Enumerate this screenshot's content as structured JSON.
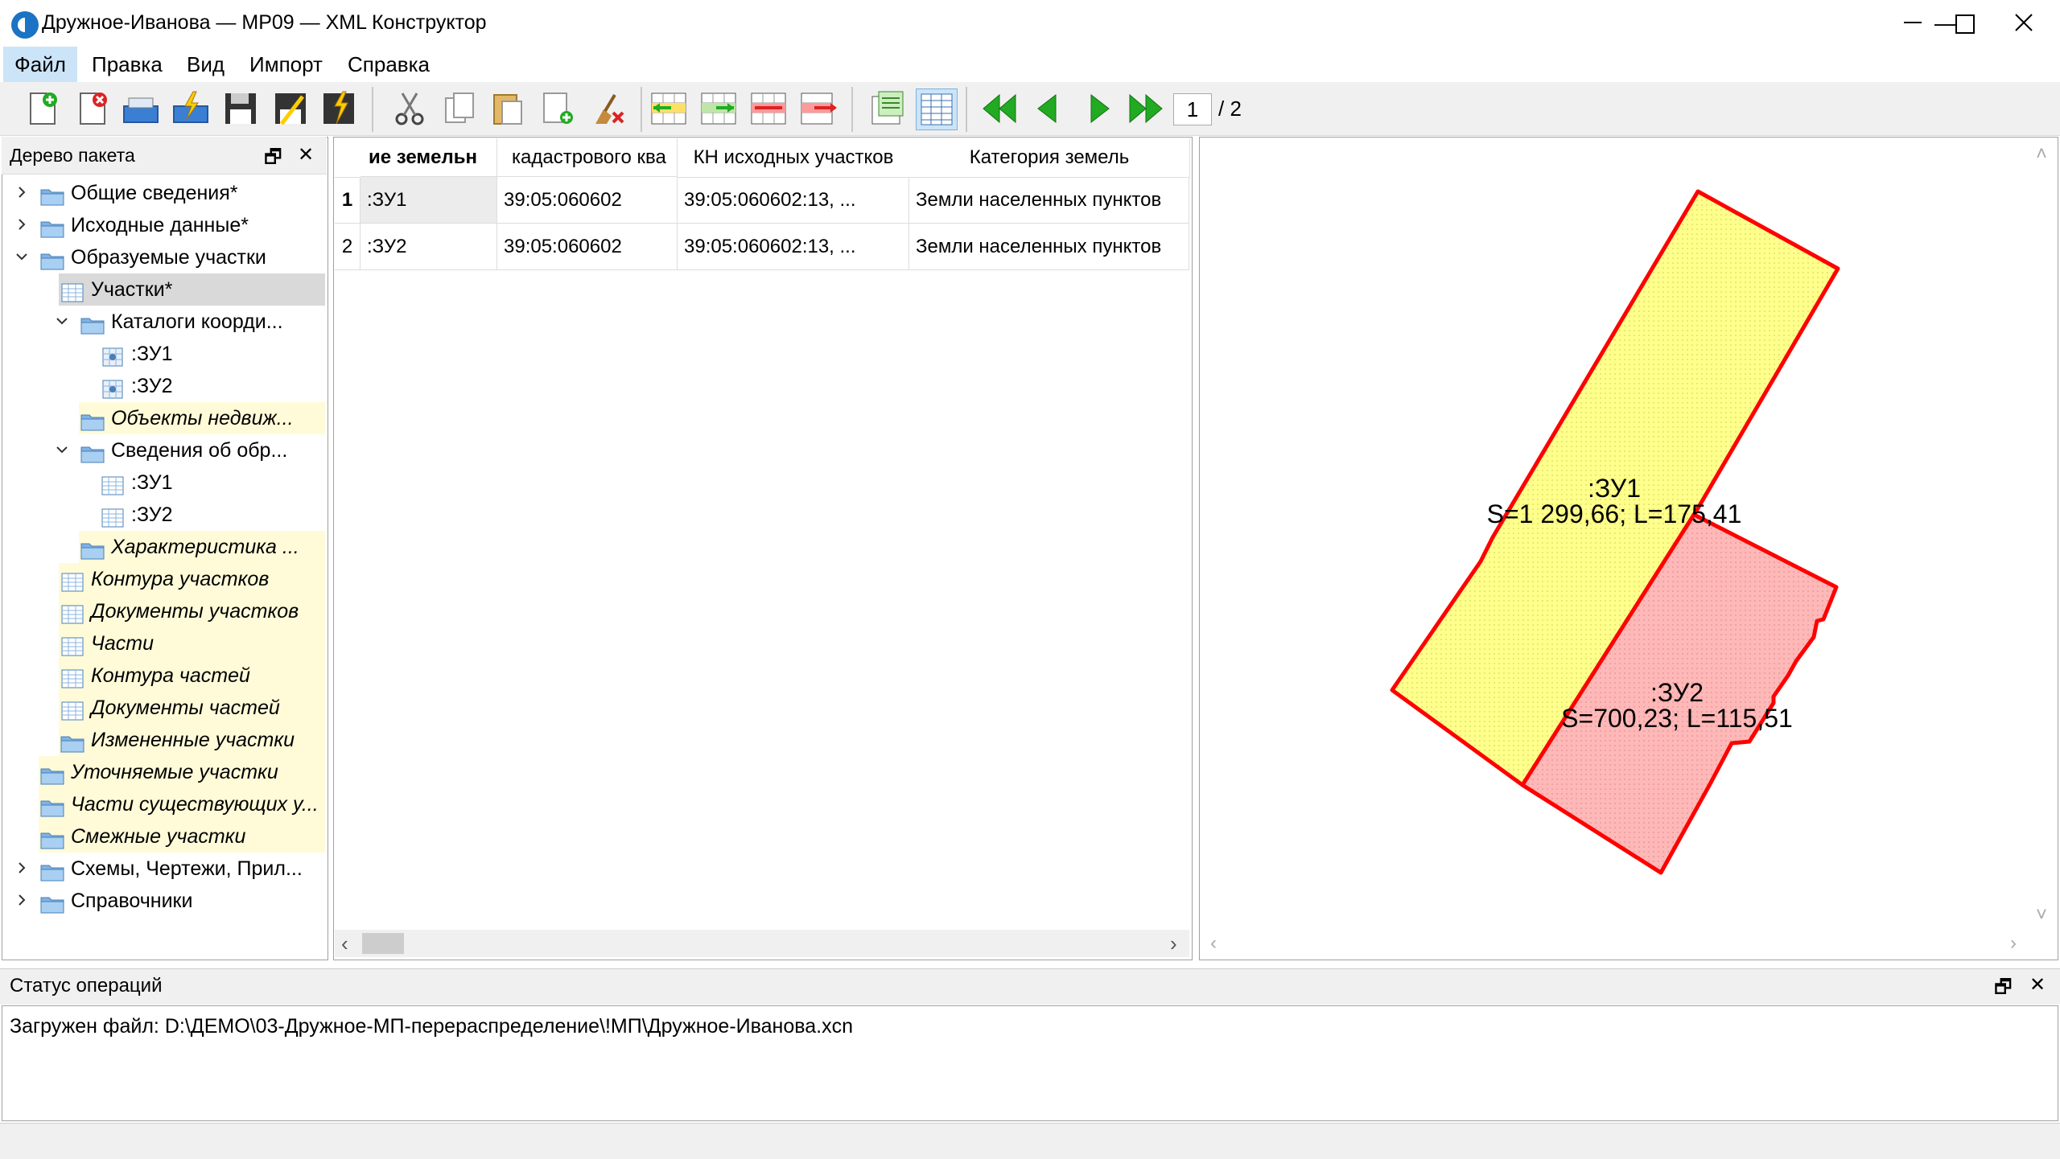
{
  "window": {
    "title": "Дружное-Иванова — МР09 — XML Конструктор",
    "minimize": "—",
    "maximize": "☐",
    "close": "✕"
  },
  "menu": [
    "Файл",
    "Правка",
    "Вид",
    "Импорт",
    "Справка"
  ],
  "toolbar": {
    "page_current": "1",
    "page_total": "/ 2"
  },
  "tree": {
    "title": "Дерево пакета",
    "items": [
      {
        "label": "Общие сведения*",
        "level": 0,
        "expander": "collapsed",
        "icon": "folder-icon",
        "style": "normal"
      },
      {
        "label": "Исходные данные*",
        "level": 0,
        "expander": "collapsed",
        "icon": "folder-icon",
        "style": "normal"
      },
      {
        "label": "Образуемые участки",
        "level": 0,
        "expander": "expanded",
        "icon": "folder-icon",
        "style": "normal"
      },
      {
        "label": "Участки*",
        "level": 1,
        "expander": "expanded",
        "icon": "table-icon",
        "style": "selected"
      },
      {
        "label": "Каталоги коорди...",
        "level": 2,
        "expander": "expanded",
        "icon": "folder-icon",
        "style": "normal"
      },
      {
        "label": ":ЗУ1",
        "level": 3,
        "expander": "none",
        "icon": "coord-table-icon",
        "style": "normal"
      },
      {
        "label": ":ЗУ2",
        "level": 3,
        "expander": "none",
        "icon": "coord-table-icon",
        "style": "normal"
      },
      {
        "label": "Объекты недвиж...",
        "level": 2,
        "expander": "collapsed",
        "icon": "folder-icon",
        "style": "yellow"
      },
      {
        "label": "Сведения об обр...",
        "level": 2,
        "expander": "expanded",
        "icon": "folder-icon",
        "style": "normal"
      },
      {
        "label": ":ЗУ1",
        "level": 3,
        "expander": "none",
        "icon": "table-icon",
        "style": "normal"
      },
      {
        "label": ":ЗУ2",
        "level": 3,
        "expander": "none",
        "icon": "table-icon",
        "style": "normal"
      },
      {
        "label": "Характеристика ...",
        "level": 2,
        "expander": "collapsed",
        "icon": "folder-icon",
        "style": "yellow"
      },
      {
        "label": "Контура участков",
        "level": 1,
        "expander": "collapsed",
        "icon": "table-icon",
        "style": "yellow"
      },
      {
        "label": "Документы участков",
        "level": 1,
        "expander": "none",
        "icon": "table-icon",
        "style": "yellow"
      },
      {
        "label": "Части",
        "level": 1,
        "expander": "collapsed",
        "icon": "table-icon",
        "style": "yellow"
      },
      {
        "label": "Контура частей",
        "level": 1,
        "expander": "collapsed",
        "icon": "table-icon",
        "style": "yellow"
      },
      {
        "label": "Документы частей",
        "level": 1,
        "expander": "none",
        "icon": "table-icon",
        "style": "yellow"
      },
      {
        "label": "Измененные участки",
        "level": 1,
        "expander": "collapsed",
        "icon": "folder-icon",
        "style": "yellow"
      },
      {
        "label": "Уточняемые участки",
        "level": 0,
        "expander": "collapsed",
        "icon": "folder-icon",
        "style": "yellow"
      },
      {
        "label": "Части существующих у...",
        "level": 0,
        "expander": "collapsed",
        "icon": "folder-icon",
        "style": "yellow"
      },
      {
        "label": "Смежные участки",
        "level": 0,
        "expander": "collapsed",
        "icon": "folder-icon",
        "style": "yellow"
      },
      {
        "label": "Схемы, Чертежи, Прил...",
        "level": 0,
        "expander": "collapsed",
        "icon": "folder-icon",
        "style": "normal"
      },
      {
        "label": "Справочники",
        "level": 0,
        "expander": "collapsed",
        "icon": "folder-icon",
        "style": "normal"
      }
    ]
  },
  "grid": {
    "columns": [
      "ие земельн",
      "кадастрового ква",
      "КН исходных участков",
      "Категория земель"
    ],
    "rows": [
      {
        "num": "1",
        "cells": [
          ":ЗУ1",
          "39:05:060602",
          "39:05:060602:13, ...",
          "Земли населенных пунктов"
        ]
      },
      {
        "num": "2",
        "cells": [
          ":ЗУ2",
          "39:05:060602",
          "39:05:060602:13, ...",
          "Земли населенных пунктов"
        ]
      }
    ],
    "scroll_left": "‹",
    "scroll_right": "›"
  },
  "map": {
    "parcels": [
      {
        "name": ":ЗУ1",
        "info": "S=1 299,66; L=175,41",
        "fill": "#ffff99",
        "stroke": "#ff0000"
      },
      {
        "name": ":ЗУ2",
        "info": "S=700,23; L=115,51",
        "fill": "#ffb6b6",
        "stroke": "#ff0000"
      }
    ],
    "scroll_left": "‹",
    "scroll_right": "›",
    "scroll_up": "˄",
    "scroll_down": "˅"
  },
  "status": {
    "title": "Статус операций",
    "message": "Загружен файл: D:\\ДЕМО\\03-Дружное-МП-перераспределение\\!МП\\Дружное-Иванова.xcn"
  },
  "panel_controls": {
    "float": "🗗",
    "close": "✕"
  }
}
